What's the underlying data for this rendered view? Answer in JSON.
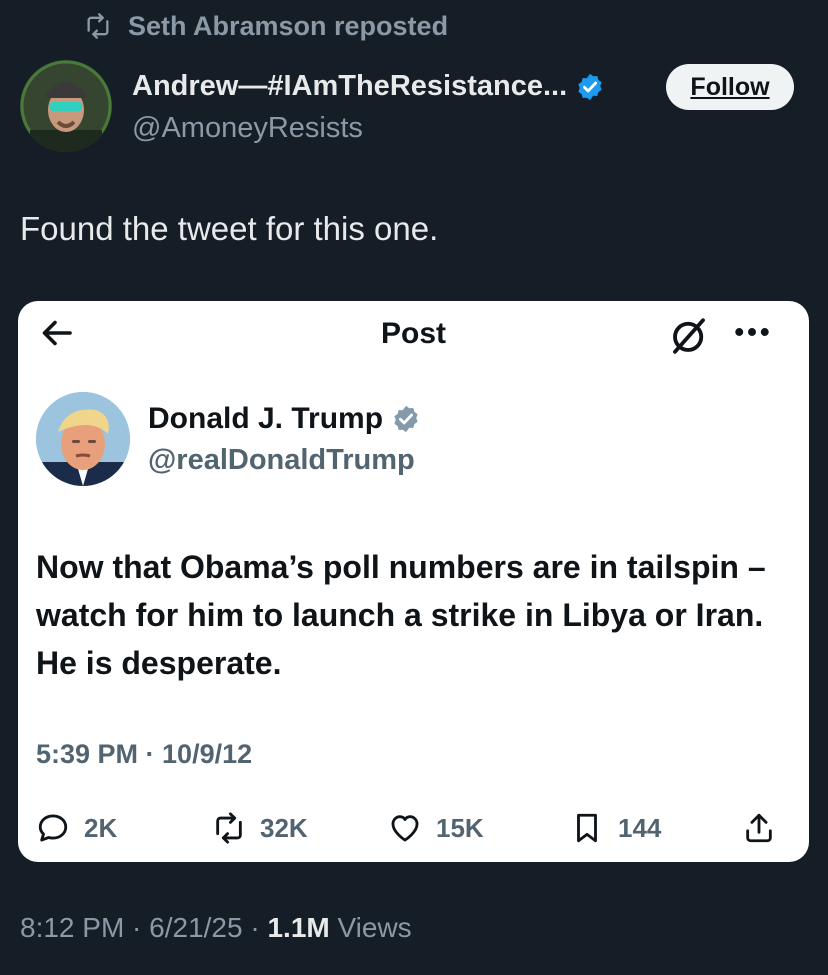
{
  "repost": {
    "text": "Seth Abramson reposted"
  },
  "author": {
    "name": "Andrew—#IAmTheResistance...",
    "handle": "@AmoneyResists",
    "follow_label": "Follow"
  },
  "tweet": {
    "text": "Found the tweet for this one."
  },
  "quoted_card": {
    "header_title": "Post",
    "author_name": "Donald J. Trump",
    "author_handle": "@realDonaldTrump",
    "body": "Now that Obama’s poll numbers are in tailspin – watch for him to launch a strike in Libya or Iran.  He is desperate.",
    "timestamp": "5:39 PM · 10/9/12",
    "actions": {
      "replies": "2K",
      "reposts": "32K",
      "likes": "15K",
      "bookmarks": "144"
    }
  },
  "footer": {
    "timestamp": "8:12 PM · 6/21/25 · ",
    "views_count": "1.1M",
    "views_label": " Views"
  },
  "colors": {
    "background": "#151d27",
    "verified_blue": "#1d9bf0",
    "muted": "#8b98a5",
    "card_muted": "#536471"
  },
  "icons": [
    "repost-icon",
    "verified-icon",
    "back-arrow-icon",
    "grok-icon",
    "more-icon",
    "reply-icon",
    "like-icon",
    "bookmark-icon",
    "share-icon"
  ]
}
